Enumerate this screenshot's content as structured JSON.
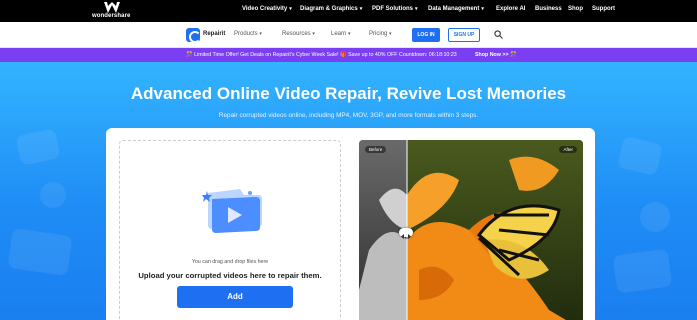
{
  "topbar": {
    "brand": "wondershare",
    "nav": [
      {
        "label": "Video Creativity",
        "caret": true
      },
      {
        "label": "Diagram & Graphics",
        "caret": true
      },
      {
        "label": "PDF Solutions",
        "caret": true
      },
      {
        "label": "Data Management",
        "caret": true
      },
      {
        "label": "Explore AI",
        "caret": false
      },
      {
        "label": "Business",
        "caret": false
      },
      {
        "label": "Shop",
        "caret": false
      },
      {
        "label": "Support",
        "caret": false
      }
    ]
  },
  "product_nav": {
    "product_name": "Repairit",
    "items": [
      "Products",
      "Resources",
      "Learn",
      "Pricing"
    ],
    "login_label": "LOG IN",
    "signup_label": "SIGN UP",
    "search_icon": "search-icon"
  },
  "promo": {
    "text": "🎊 Limited Time Offer! Get Deals on Repairit's Cyber Week Sale! 🎁 Save up to 40% OFF Countdown: 06:18:10:23",
    "shop_label": "Shop Now >> 🎊"
  },
  "hero": {
    "title": "Advanced Online Video Repair, Revive Lost Memories",
    "subtitle": "Repair corrupted videos online, including MP4, MOV, 3GP, and more formats within 3 steps."
  },
  "upload": {
    "hint": "You can drag and drop files here",
    "main_text": "Upload your corrupted videos here to repair them.",
    "add_label": "Add"
  },
  "compare": {
    "before_label": "Before",
    "after_label": "After"
  },
  "colors": {
    "brand_blue": "#1f6ff3",
    "promo_purple": "#7a3ff2",
    "hero_top": "#33b4ff",
    "hero_bottom": "#1a7ff0"
  }
}
